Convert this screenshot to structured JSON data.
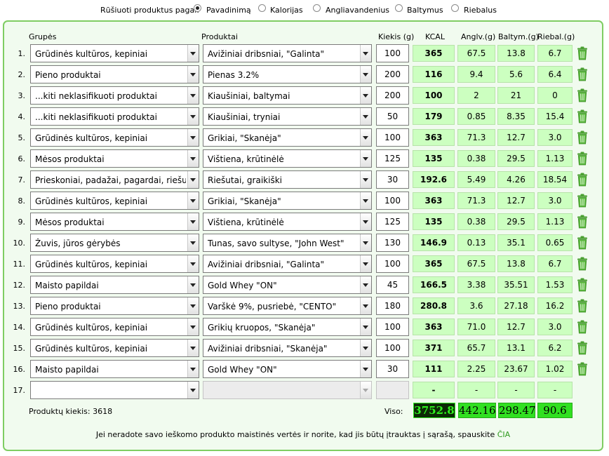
{
  "sort": {
    "label": "Rūšiuoti produktus pagal:",
    "options": [
      "Pavadinimą",
      "Kalorijas",
      "Angliavandenius",
      "Baltymus",
      "Riebalus"
    ],
    "selected": "Pavadinimą"
  },
  "headers": {
    "group": "Grupės",
    "product": "Produktai",
    "qty": "Kiekis (g)",
    "kcal": "KCAL",
    "carbs": "Anglv.(g)",
    "protein": "Baltym.(g)",
    "fat": "Riebal.(g)"
  },
  "rows": [
    {
      "num": "1.",
      "group": "Grūdinės kultūros, kepiniai",
      "product": "Avižiniai dribsniai, \"Galinta\"",
      "qty": "100",
      "kcal": "365",
      "carbs": "67.5",
      "protein": "13.8",
      "fat": "6.7"
    },
    {
      "num": "2.",
      "group": "Pieno produktai",
      "product": "Pienas 3.2%",
      "qty": "200",
      "kcal": "116",
      "carbs": "9.4",
      "protein": "5.6",
      "fat": "6.4"
    },
    {
      "num": "3.",
      "group": "...kiti neklasifikuoti produktai",
      "product": "Kiaušiniai, baltymai",
      "qty": "200",
      "kcal": "100",
      "carbs": "2",
      "protein": "21",
      "fat": "0"
    },
    {
      "num": "4.",
      "group": "...kiti neklasifikuoti produktai",
      "product": "Kiaušiniai, tryniai",
      "qty": "50",
      "kcal": "179",
      "carbs": "0.85",
      "protein": "8.35",
      "fat": "15.4"
    },
    {
      "num": "5.",
      "group": "Grūdinės kultūros, kepiniai",
      "product": "Grikiai, \"Skanėja\"",
      "qty": "100",
      "kcal": "363",
      "carbs": "71.3",
      "protein": "12.7",
      "fat": "3.0"
    },
    {
      "num": "6.",
      "group": "Mėsos produktai",
      "product": "Vištiena, krūtinėlė",
      "qty": "125",
      "kcal": "135",
      "carbs": "0.38",
      "protein": "29.5",
      "fat": "1.13"
    },
    {
      "num": "7.",
      "group": "Prieskoniai, padažai, pagardai, riešutai",
      "product": "Riešutai, graikiški",
      "qty": "30",
      "kcal": "192.6",
      "carbs": "5.49",
      "protein": "4.26",
      "fat": "18.54"
    },
    {
      "num": "8.",
      "group": "Grūdinės kultūros, kepiniai",
      "product": "Grikiai, \"Skanėja\"",
      "qty": "100",
      "kcal": "363",
      "carbs": "71.3",
      "protein": "12.7",
      "fat": "3.0"
    },
    {
      "num": "9.",
      "group": "Mėsos produktai",
      "product": "Vištiena, krūtinėlė",
      "qty": "125",
      "kcal": "135",
      "carbs": "0.38",
      "protein": "29.5",
      "fat": "1.13"
    },
    {
      "num": "10.",
      "group": "Žuvis, jūros gėrybės",
      "product": "Tunas, savo sultyse, \"John West\"",
      "qty": "130",
      "kcal": "146.9",
      "carbs": "0.13",
      "protein": "35.1",
      "fat": "0.65"
    },
    {
      "num": "11.",
      "group": "Grūdinės kultūros, kepiniai",
      "product": "Avižiniai dribsniai, \"Galinta\"",
      "qty": "100",
      "kcal": "365",
      "carbs": "67.5",
      "protein": "13.8",
      "fat": "6.7"
    },
    {
      "num": "12.",
      "group": "Maisto papildai",
      "product": "Gold Whey \"ON\"",
      "qty": "45",
      "kcal": "166.5",
      "carbs": "3.38",
      "protein": "35.51",
      "fat": "1.53"
    },
    {
      "num": "13.",
      "group": "Pieno produktai",
      "product": "Varškė 9%, pusriebė, \"CENTO\"",
      "qty": "180",
      "kcal": "280.8",
      "carbs": "3.6",
      "protein": "27.18",
      "fat": "16.2"
    },
    {
      "num": "14.",
      "group": "Grūdinės kultūros, kepiniai",
      "product": "Grikių kruopos, \"Skanėja\"",
      "qty": "100",
      "kcal": "363",
      "carbs": "71.0",
      "protein": "12.7",
      "fat": "3.0"
    },
    {
      "num": "15.",
      "group": "Grūdinės kultūros, kepiniai",
      "product": "Avižiniai dribsniai, \"Skanėja\"",
      "qty": "100",
      "kcal": "371",
      "carbs": "65.7",
      "protein": "13.1",
      "fat": "6.2"
    },
    {
      "num": "16.",
      "group": "Maisto papildai",
      "product": "Gold Whey \"ON\"",
      "qty": "30",
      "kcal": "111",
      "carbs": "2.25",
      "protein": "23.67",
      "fat": "1.02"
    }
  ],
  "empty_row": {
    "num": "17.",
    "group": "",
    "product": "",
    "qty": "",
    "kcal": "-",
    "carbs": "-",
    "protein": "-",
    "fat": "-"
  },
  "footer": {
    "count_label": "Produktų kiekis: 3618",
    "total_label": "Viso:",
    "total_kcal": "3752.8",
    "total_carbs": "442.16",
    "total_protein": "298.47",
    "total_fat": "90.6",
    "note": "Jei neradote savo ieškomo produkto maistinės vertės ir norite, kad jis būtų įtrauktas į sąrašą, spauskite",
    "link": "ČIA"
  },
  "colors": {
    "accent": "#7fcd63",
    "cell": "#ccffc0",
    "total": "#31e021",
    "link": "#2e9a1e"
  },
  "icons": {
    "delete": "trash-icon",
    "dropdown": "chevron-down-icon"
  }
}
